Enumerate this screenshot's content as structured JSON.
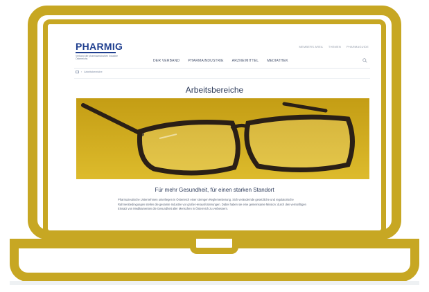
{
  "brand": {
    "name": "PHARMIG",
    "tagline": "Verband der pharmazeutischen Industrie Österreichs"
  },
  "top_nav": [
    "MEMBERS AREA",
    "THEMEN",
    "PHARMAGUIDE"
  ],
  "main_nav": [
    "DER VERBAND",
    "PHARMAINDUSTRIE",
    "ARZNEIMITTEL",
    "MEDIATHEK"
  ],
  "breadcrumb": {
    "current": "Arbeitsbereiche"
  },
  "page": {
    "title": "Arbeitsbereiche",
    "subheading": "Für mehr Gesundheit, für einen starken Standort",
    "body": "Pharmazeutische Unternehmen unterliegen in Österreich einer strengen Reglementierung. Sich verändernde gesetzliche und regulatorische Rahmenbedingungen stellen die gesamte Industrie vor große Herausforderungen. Dabei haben sie eine gemeinsame Mission: durch den vernünftigen Einsatz von Medikamenten die Gesundheit aller Menschen in Österreich zu verbessern."
  },
  "colors": {
    "frame": "#c7a723",
    "brand_blue": "#1f3f8f",
    "hero_background": "#d2ad1c"
  },
  "icons": {
    "search": "search-icon",
    "home": "home-icon"
  }
}
